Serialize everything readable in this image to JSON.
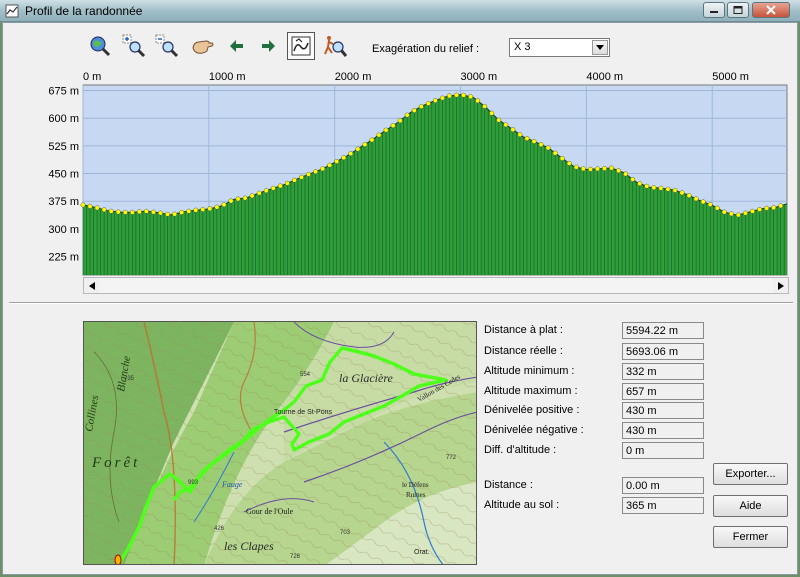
{
  "window": {
    "title": "Profil de la randonnée"
  },
  "toolbar": {
    "exaggeration_label": "Exagération du relief :",
    "exaggeration_value": "X 3",
    "tools": [
      "zoom-globe-icon",
      "zoom-in-icon",
      "zoom-out-icon",
      "pan-hand-icon",
      "arrow-left-icon",
      "arrow-right-icon",
      "profile-mode-icon",
      "walker-search-icon"
    ]
  },
  "chart_data": {
    "type": "area",
    "x_unit": "m",
    "y_unit": "m",
    "xlim": [
      0,
      5594.22
    ],
    "ylim": [
      175,
      690
    ],
    "x_ticks": [
      "0 m",
      "1000 m",
      "2000 m",
      "3000 m",
      "4000 m",
      "5000 m"
    ],
    "x_tick_values": [
      0,
      1000,
      2000,
      3000,
      4000,
      5000
    ],
    "y_ticks": [
      "675 m",
      "600 m",
      "525 m",
      "450 m",
      "375 m",
      "300 m",
      "225 m"
    ],
    "y_tick_values": [
      675,
      600,
      525,
      450,
      375,
      300,
      225
    ],
    "grid": true,
    "fill_color": "#2e9e3a",
    "bg_color": "#c7d9f2",
    "marker_color": "#ffff00",
    "series": [
      {
        "x": [
          0,
          100,
          200,
          300,
          400,
          500,
          600,
          700,
          800,
          900,
          1000,
          1100,
          1200,
          1300,
          1400,
          1500,
          1600,
          1700,
          1800,
          1900,
          2000,
          2100,
          2200,
          2300,
          2400,
          2500,
          2600,
          2700,
          2800,
          2900,
          3000,
          3100,
          3200,
          3300,
          3400,
          3500,
          3600,
          3700,
          3800,
          3900,
          4000,
          4100,
          4200,
          4300,
          4400,
          4500,
          4600,
          4700,
          4800,
          4900,
          5000,
          5100,
          5200,
          5300,
          5400,
          5500,
          5594
        ],
        "y": [
          365,
          358,
          349,
          345,
          345,
          348,
          344,
          338,
          346,
          351,
          354,
          362,
          380,
          384,
          397,
          409,
          420,
          435,
          449,
          462,
          480,
          498,
          520,
          542,
          566,
          588,
          615,
          634,
          648,
          660,
          664,
          657,
          630,
          596,
          573,
          549,
          535,
          519,
          493,
          469,
          461,
          463,
          465,
          452,
          426,
          413,
          410,
          405,
          393,
          377,
          364,
          345,
          337,
          346,
          355,
          358,
          368
        ]
      }
    ]
  },
  "stats": {
    "rows": [
      {
        "label": "Distance à plat :",
        "value": "5594.22 m"
      },
      {
        "label": "Distance réelle :",
        "value": "5693.06 m"
      },
      {
        "label": "Altitude minimum :",
        "value": "332 m"
      },
      {
        "label": "Altitude maximum :",
        "value": "657 m"
      },
      {
        "label": "Dénivelée positive :",
        "value": "430 m"
      },
      {
        "label": "Dénivelée négative :",
        "value": "430 m"
      },
      {
        "label": "Diff. d'altitude :",
        "value": "0 m"
      }
    ],
    "cursor_rows": [
      {
        "label": "Distance :",
        "value": "0.00 m"
      },
      {
        "label": "Altitude au sol :",
        "value": "365 m"
      }
    ]
  },
  "buttons": {
    "export": "Exporter...",
    "help": "Aide",
    "close": "Fermer"
  },
  "map": {
    "labels": [
      "la Glacière",
      "Tourne de St-Pons",
      "Forêt",
      "Fauge",
      "Gour de l'Oule",
      "les Clapes",
      "le Défens",
      "Ruines",
      "Collines",
      "Blanche",
      "Vallon des Cedes",
      "Orat.",
      "554",
      "735",
      "703",
      "726",
      "772",
      "426",
      "993"
    ],
    "route_color": "#4dff1a"
  }
}
